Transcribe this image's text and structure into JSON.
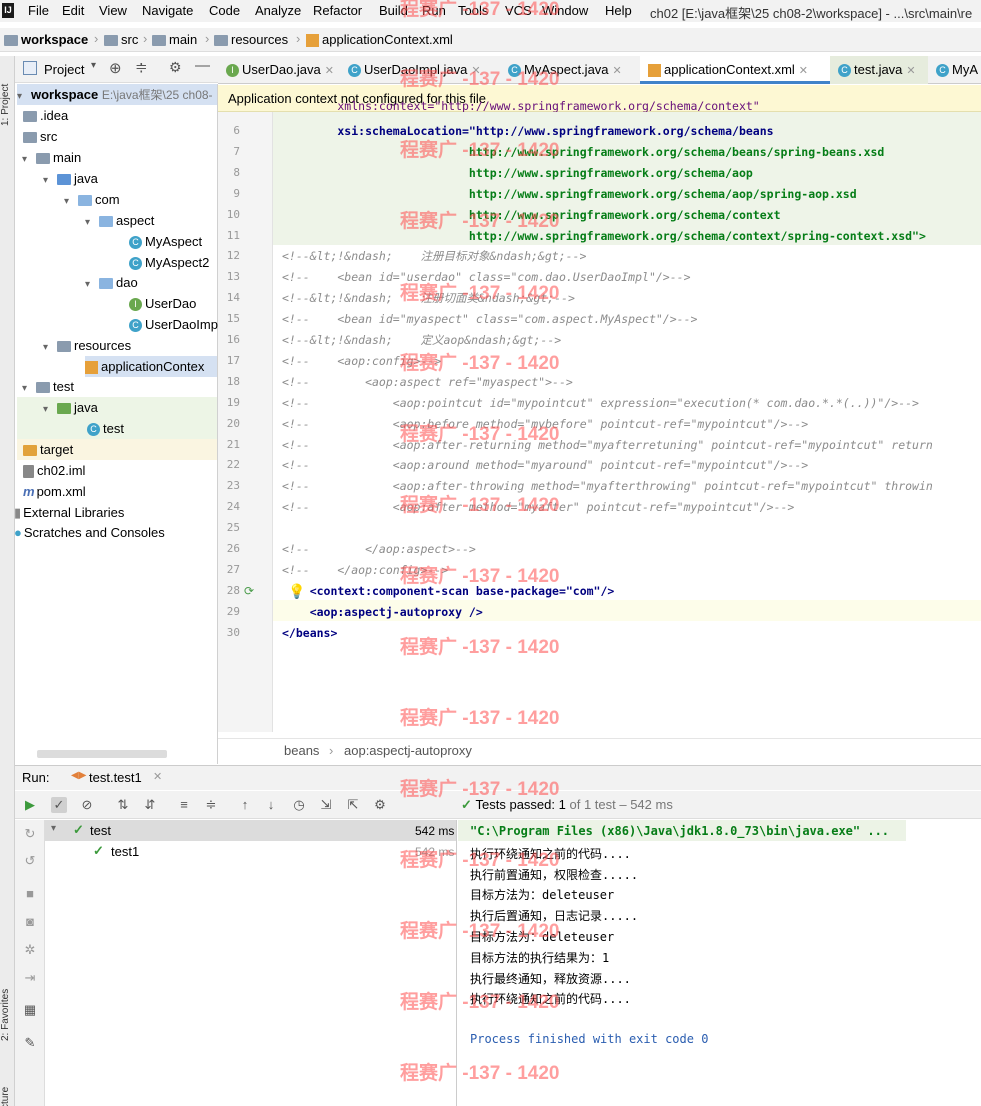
{
  "menubar": {
    "logo": "IJ",
    "items": [
      "File",
      "Edit",
      "View",
      "Navigate",
      "Code",
      "Analyze",
      "Refactor",
      "Build",
      "Run",
      "Tools",
      "VCS",
      "Window",
      "Help"
    ],
    "title": "ch02 [E:\\java框架\\25 ch08-2\\workspace] - ...\\src\\main\\re"
  },
  "nav": {
    "crumbs": [
      "workspace",
      "src",
      "main",
      "resources",
      "applicationContext.xml"
    ]
  },
  "leftstripe": {
    "project": "1: Project",
    "favorites": "2: Favorites",
    "structure": "Z: Structure"
  },
  "project": {
    "header": "Project",
    "root": "workspace",
    "root_path": "E:\\java框架\\25 ch08-",
    "nodes": [
      ".idea",
      "src",
      "main",
      "java",
      "com",
      "aspect",
      "MyAspect",
      "MyAspect2",
      "dao",
      "UserDao",
      "UserDaoImp",
      "resources",
      "applicationContex",
      "test",
      "java",
      "test",
      "target",
      "ch02.iml",
      "pom.xml",
      "External Libraries",
      "Scratches and Consoles"
    ]
  },
  "tabs": [
    "UserDao.java",
    "UserDaoImpl.java",
    "MyAspect.java",
    "applicationContext.xml",
    "test.java",
    "MyA"
  ],
  "banner": "Application context not configured for this file",
  "editor": {
    "lines": [
      {
        "n": "6",
        "t": "        xsi:schemaLocation=\"http://www.springframework.org/schema/beans"
      },
      {
        "n": "7",
        "t": "                           http://www.springframework.org/schema/beans/spring-beans.xsd"
      },
      {
        "n": "8",
        "t": "                           http://www.springframework.org/schema/aop"
      },
      {
        "n": "9",
        "t": "                           http://www.springframework.org/schema/aop/spring-aop.xsd"
      },
      {
        "n": "10",
        "t": "                           http://www.springframework.org/schema/context"
      },
      {
        "n": "11",
        "t": "                           http://www.springframework.org/schema/context/spring-context.xsd\">"
      },
      {
        "n": "12",
        "t": "<!--&lt;!&ndash;    注册目标对象&ndash;&gt;-->"
      },
      {
        "n": "13",
        "t": "<!--    <bean id=\"userdao\" class=\"com.dao.UserDaoImpl\"/>-->"
      },
      {
        "n": "14",
        "t": "<!--&lt;!&ndash;    注册切面类&ndash;&gt;-->"
      },
      {
        "n": "15",
        "t": "<!--    <bean id=\"myaspect\" class=\"com.aspect.MyAspect\"/>-->"
      },
      {
        "n": "16",
        "t": "<!--&lt;!&ndash;    定义aop&ndash;&gt;-->"
      },
      {
        "n": "17",
        "t": "<!--    <aop:config>-->"
      },
      {
        "n": "18",
        "t": "<!--        <aop:aspect ref=\"myaspect\">-->"
      },
      {
        "n": "19",
        "t": "<!--            <aop:pointcut id=\"mypointcut\" expression=\"execution(* com.dao.*.*(..))\"/>-->"
      },
      {
        "n": "20",
        "t": "<!--            <aop:before method=\"mybefore\" pointcut-ref=\"mypointcut\"/>-->"
      },
      {
        "n": "21",
        "t": "<!--            <aop:after-returning method=\"myafterretuning\" pointcut-ref=\"mypointcut\" return"
      },
      {
        "n": "22",
        "t": "<!--            <aop:around method=\"myaround\" pointcut-ref=\"mypointcut\"/>-->"
      },
      {
        "n": "23",
        "t": "<!--            <aop:after-throwing method=\"myafterthrowing\" pointcut-ref=\"mypointcut\" throwin"
      },
      {
        "n": "24",
        "t": "<!--            <aop:after method=\"myafter\" pointcut-ref=\"mypointcut\"/>-->"
      },
      {
        "n": "25",
        "t": ""
      },
      {
        "n": "26",
        "t": "<!--        </aop:aspect>-->"
      },
      {
        "n": "27",
        "t": "<!--    </aop:config>-->"
      },
      {
        "n": "28",
        "t": "    <context:component-scan base-package=\"com\"/>"
      },
      {
        "n": "29",
        "t": "    <aop:aspectj-autoproxy />"
      },
      {
        "n": "30",
        "t": "</beans>"
      }
    ],
    "line5_partial": "        xmlns:context=\"http://www.springframework.org/schema/context\"",
    "breadcrumb": [
      "beans",
      "aop:aspectj-autoproxy"
    ]
  },
  "run": {
    "label": "Run:",
    "tab": "test.test1",
    "status_prefix": "Tests passed:",
    "status_count": "1",
    "status_suffix": "of 1 test – 542 ms",
    "tree": [
      {
        "name": "test",
        "time": "542 ms"
      },
      {
        "name": "test1",
        "time": "542 ms"
      }
    ],
    "console": [
      "\"C:\\Program Files (x86)\\Java\\jdk1.8.0_73\\bin\\java.exe\" ...",
      "执行环绕通知之前的代码....",
      "执行前置通知，权限检查.....",
      "目标方法为：deleteuser",
      "执行后置通知，日志记录.....",
      "目标方法为：deleteuser",
      "目标方法的执行结果为：1",
      "执行最终通知，释放资源....",
      "执行环绕通知之前的代码....",
      "",
      "Process finished with exit code 0"
    ]
  },
  "watermark": "程赛广 -137 - 1420",
  "colors": {
    "comment": "#8c8c8c",
    "string": "#067d17",
    "tag": "#000080",
    "banner": "#fdf8d3",
    "pass": "#3c9a3c",
    "process": "#2a5db0"
  }
}
